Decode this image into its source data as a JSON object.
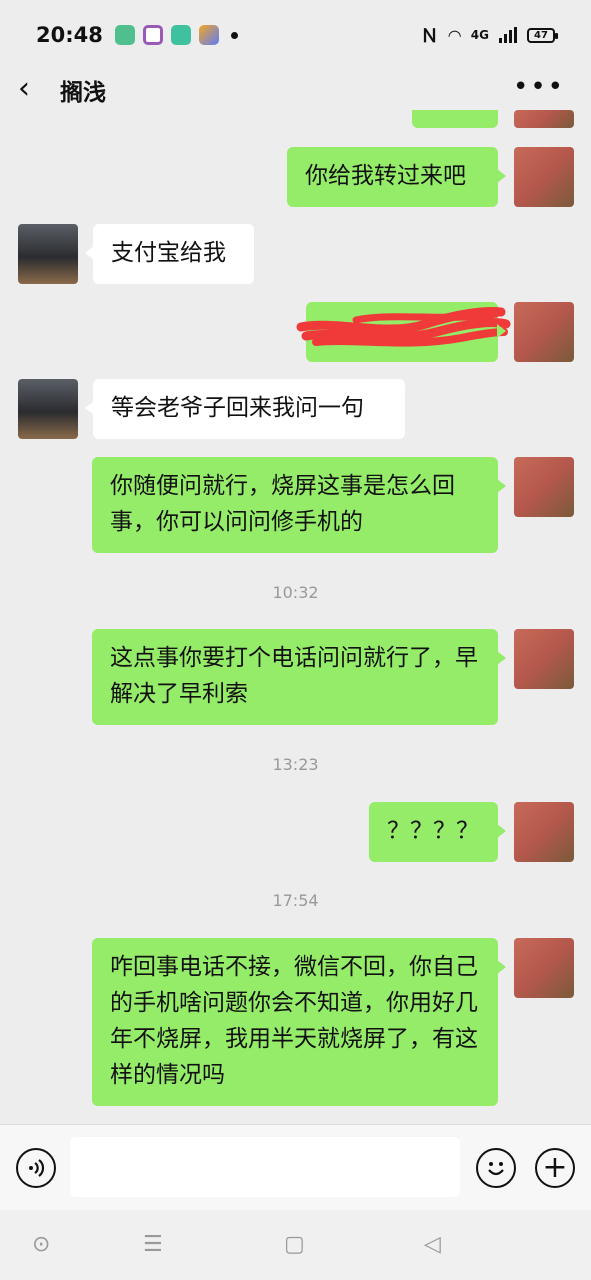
{
  "status_bar": {
    "time": "20:48",
    "network": "4G",
    "battery": "47",
    "colors": {
      "app1": "#4fc08d",
      "app2": "#9b59b6",
      "app3": "#3fc1a0",
      "app4": "#5b7cfa"
    }
  },
  "header": {
    "back_icon": "chevron-left-icon",
    "title": "搁浅",
    "more_icon": "more-dots-icon"
  },
  "messages": [
    {
      "sender": "me",
      "text": "你给我转过来吧"
    },
    {
      "sender": "other",
      "text": "支付宝给我"
    },
    {
      "sender": "me",
      "text": "",
      "redacted": true
    },
    {
      "sender": "other",
      "text": "等会老爷子回来我问一句"
    },
    {
      "sender": "me",
      "text": "你随便问就行，烧屏这事是怎么回事，你可以问问修手机的"
    },
    {
      "type": "time",
      "text": "10:32"
    },
    {
      "sender": "me",
      "text": "这点事你要打个电话问问就行了，早解决了早利索"
    },
    {
      "type": "time",
      "text": "13:23"
    },
    {
      "sender": "me",
      "text": "？？？？"
    },
    {
      "type": "time",
      "text": "17:54"
    },
    {
      "sender": "me",
      "text": "咋回事电话不接，微信不回，你自己的手机啥问题你会不知道，你用好几年不烧屏，我用半天就烧屏了，有这样的情况吗"
    }
  ],
  "input_bar": {
    "voice_icon": "voice-icon",
    "emoji_icon": "emoji-icon",
    "plus_icon": "plus-icon",
    "placeholder": ""
  },
  "colors": {
    "bubble_me": "#95ec69",
    "bubble_other": "#ffffff",
    "background": "#ededed"
  }
}
